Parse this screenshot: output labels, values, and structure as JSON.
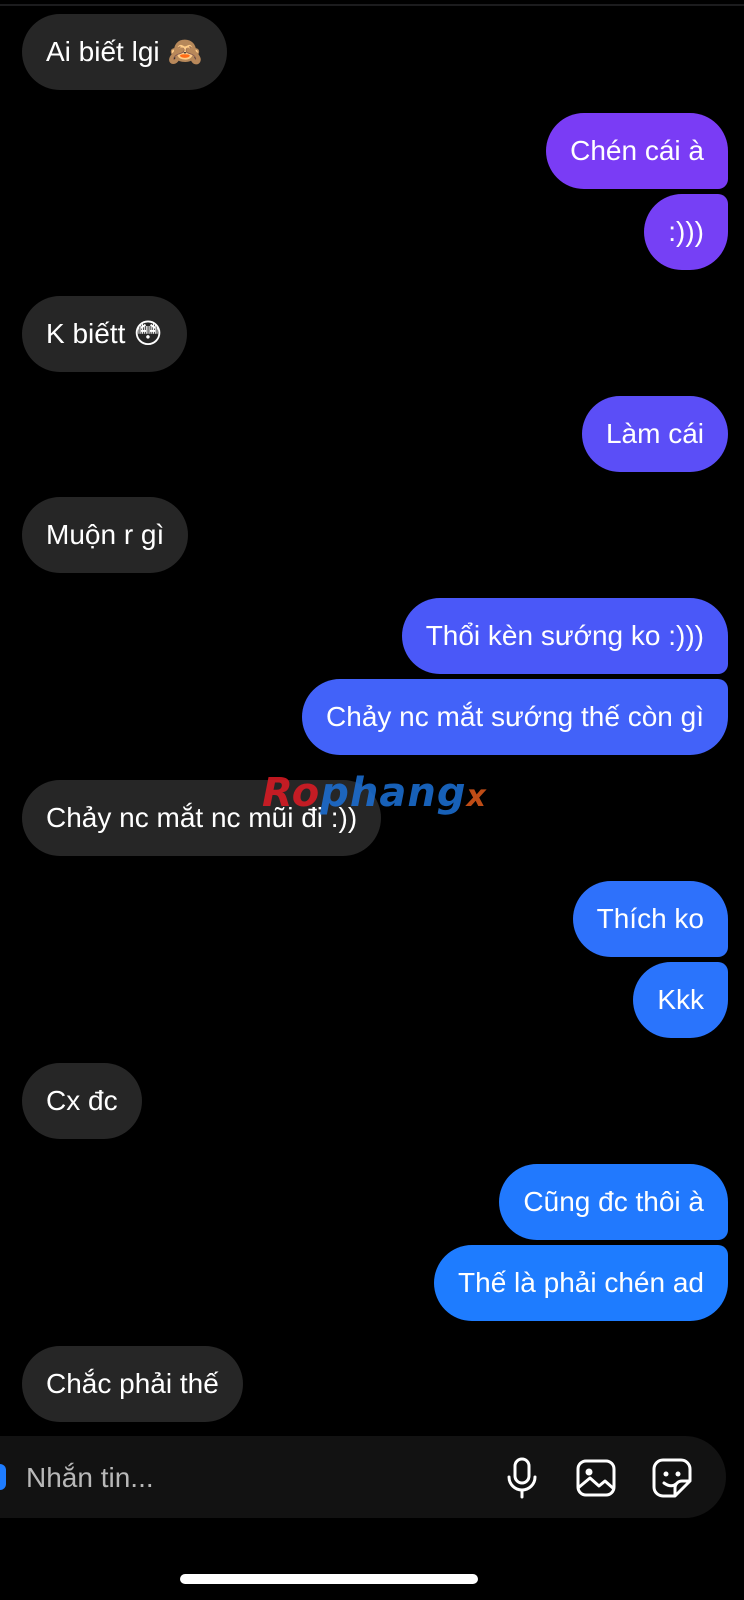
{
  "messages": [
    {
      "text": "Ai biết lgi",
      "emoji": "🙈"
    },
    {
      "text": "Chén cái à"
    },
    {
      "text": ":)))"
    },
    {
      "text": "K biếtt",
      "emoji": "😳"
    },
    {
      "text": "Làm cái"
    },
    {
      "text": "Muộn r gì"
    },
    {
      "text": "Thổi kèn sướng ko :)))"
    },
    {
      "text": "Chảy nc mắt sướng thế còn gì"
    },
    {
      "text": "Chảy nc mắt nc mũi đi :))"
    },
    {
      "text": "Thích ko"
    },
    {
      "text": "Kkk"
    },
    {
      "text": "Cx đc"
    },
    {
      "text": "Cũng đc thôi à"
    },
    {
      "text": "Thế là phải chén ad"
    },
    {
      "text": "Chắc phải thế"
    }
  ],
  "watermark": {
    "part1": "Ro",
    "part2": "phang",
    "part3": "x"
  },
  "composer": {
    "placeholder": "Nhắn tin...",
    "mic_icon": "microphone-icon",
    "image_icon": "image-icon",
    "sticker_icon": "sticker-icon"
  },
  "colors": {
    "received_bubble": "#262626",
    "sent_gradient": [
      "#7a3cf5",
      "#5b4ef7",
      "#3a66f9",
      "#1e7cff"
    ],
    "background": "#000000"
  }
}
